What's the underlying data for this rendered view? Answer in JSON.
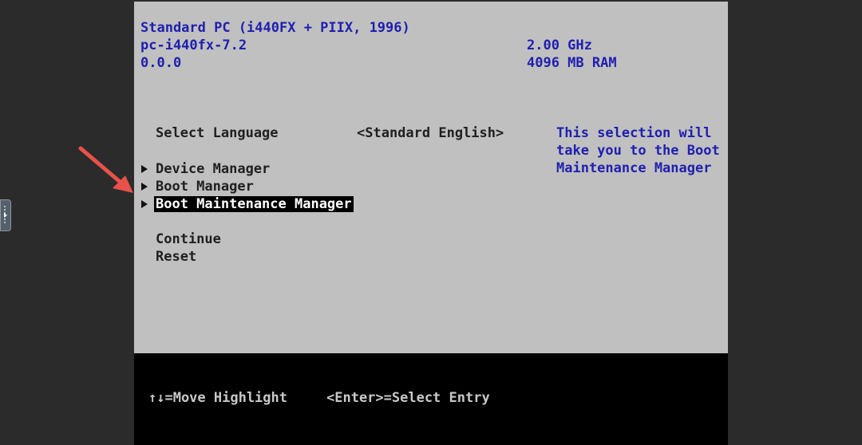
{
  "sysinfo": {
    "machine": "Standard PC (i440FX + PIIX, 1996)",
    "model": "pc-i440fx-7.2",
    "version": "0.0.0",
    "cpu": "2.00 GHz",
    "ram": "4096 MB RAM"
  },
  "menu": {
    "language_label": "Select Language",
    "language_value": "<Standard English>",
    "items": [
      {
        "label": "Device Manager"
      },
      {
        "label": "Boot Manager"
      },
      {
        "label": "Boot Maintenance Manager"
      }
    ],
    "continue_label": "Continue",
    "reset_label": "Reset"
  },
  "help": {
    "line1": "This selection will",
    "line2": "take you to the Boot",
    "line3": "Maintenance Manager"
  },
  "footer": {
    "move_hint": "↑↓=Move Highlight",
    "enter_hint": "<Enter>=Select Entry"
  },
  "colors": {
    "screen_bg": "#c0c0c0",
    "info_text": "#1f1fb0",
    "footer_bg": "#000000",
    "annotation_arrow": "#e8524a"
  },
  "icons": {
    "submenu": "triangle-right-icon",
    "annotation": "red-arrow-icon",
    "side_handle": "drawer-handle-icon"
  }
}
